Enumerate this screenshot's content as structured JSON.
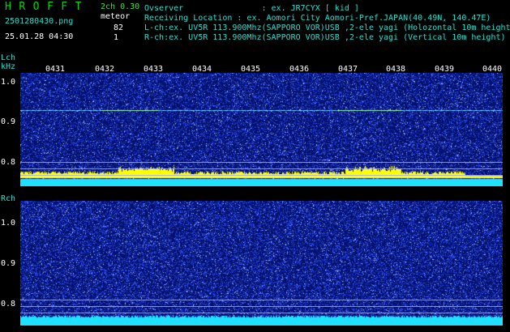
{
  "header": {
    "logo": "HROFFT",
    "filename": "2501280430.png",
    "datetime": "25.01.28 04:30",
    "mode": "2ch 0.30",
    "meteor_label": "meteor",
    "count_l": "82",
    "count_r": "1",
    "observer": "Ovserver                : ex. JR7CYX [ kid ]",
    "location": "Receiving Location : ex. Aomori City Aomori-Pref.JAPAN(40.49N, 140.47E)",
    "lch_info": "L-ch:ex. UV5R 113.900Mhz(SAPPORO VOR)USB ,2-ele yagi (Holozontal 10m height",
    "rch_info": "R-ch:ex. UV5R 113.900Mhz(SAPPORO VOR)USB ,2-ele yagi (Vertical 10m height)"
  },
  "time_ticks": [
    "0431",
    "0432",
    "0433",
    "0434",
    "0435",
    "0436",
    "0437",
    "0438",
    "0439",
    "0440"
  ],
  "lch": {
    "label": "Lch",
    "unit": "kHz",
    "y_labels": [
      "1.0",
      "0.9",
      "0.8"
    ]
  },
  "rch": {
    "label": "Rch",
    "y_labels": [
      "1.0",
      "0.9",
      "0.8"
    ]
  },
  "colors": {
    "background": "#04126e",
    "noise": "#3a5aff",
    "signal": "#ffff00",
    "baseline": "#1ee0ff",
    "text": "#26e0d0"
  }
}
